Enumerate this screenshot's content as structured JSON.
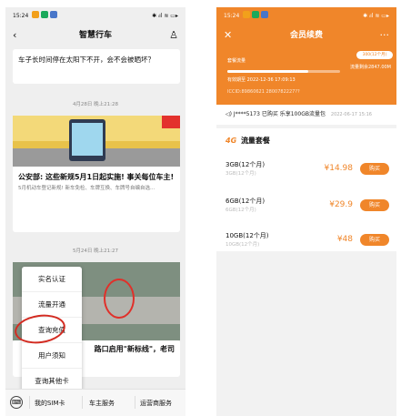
{
  "left": {
    "status": {
      "time": "15:24",
      "signal": "✱ ᵢıl ≋ ▭▸"
    },
    "title": "智慧行车",
    "back_icon": "‹",
    "user_icon": "♙",
    "question": "车子长时间停在太阳下不开，会不会被晒坏？",
    "date1": "4月28日 晚上21:28",
    "article1": {
      "headline": "公安部: 这些新规5月1日起实施! 事关每位车主!",
      "summary": "5月机动车登记新规! 新车免检、车牌互换、车牌号自编自选...",
      "image_label": "新规实施"
    },
    "date2": "5月24日 晚上21:27",
    "article2_frag": "路口启用\"新标线\"，老司",
    "article2_frag_left": "扌",
    "menu": [
      "实名认证",
      "流量开通",
      "查询充值",
      "用户须知",
      "查询其他卡"
    ],
    "tabs": [
      "我的SIM卡",
      "车主服务",
      "运营商服务"
    ],
    "keyboard_icon": "⌨"
  },
  "right": {
    "status": {
      "time": "15:24",
      "signal": "✱ ᵢıl ≋ ▭▸"
    },
    "title": "会员续费",
    "close_icon": "✕",
    "more_icon": "···",
    "card": {
      "tag": "300(12个月)",
      "name": "套餐流量",
      "quota": "流量剩余2847.00M",
      "expiry": "有效期至 2022-12-36 17:09:13",
      "iccid": "ICCID:89860621 2800782227??",
      "progress": 0.72
    },
    "notice": {
      "icon": "◁)",
      "text": "J****5173 已购买 乐享100GB流量包",
      "time": "2022-06-17 15:16"
    },
    "section_title": "流量套餐",
    "section_icon": "4G",
    "packages": [
      {
        "name": "3GB(12个月)",
        "sub": "3GB(12个月)",
        "price": "¥14.98",
        "button": "购买"
      },
      {
        "name": "6GB(12个月)",
        "sub": "6GB(12个月)",
        "price": "¥29.9",
        "button": "购买"
      },
      {
        "name": "10GB(12个月)",
        "sub": "10GB(12个月)",
        "price": "¥48",
        "button": "购买"
      }
    ]
  },
  "colors": {
    "accent": "#f0862a",
    "highlight_ring": "#d32c22"
  }
}
